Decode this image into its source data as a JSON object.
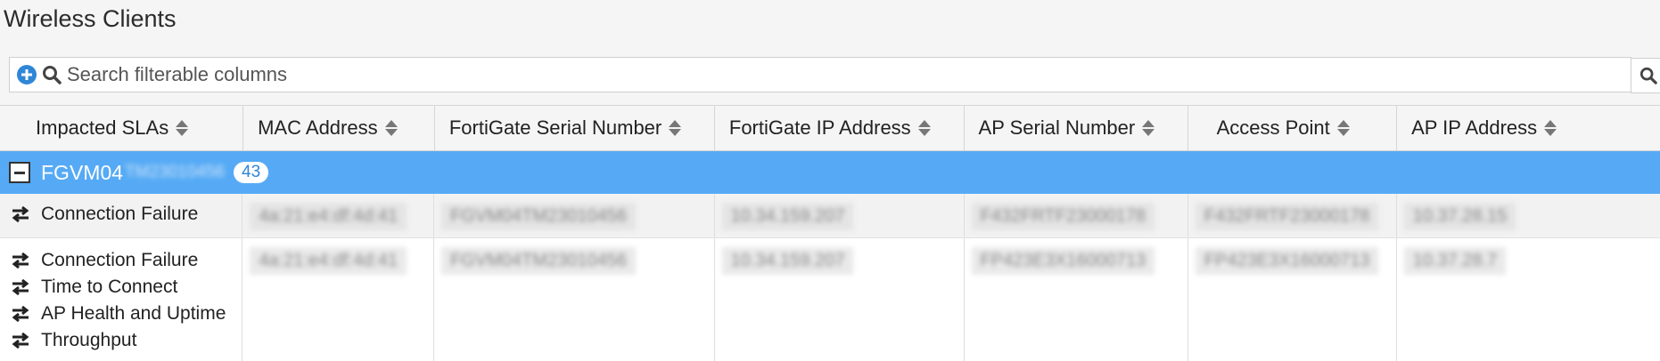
{
  "page": {
    "title": "Wireless Clients"
  },
  "search": {
    "placeholder": "Search filterable columns"
  },
  "columns": [
    {
      "label": "Impacted SLAs"
    },
    {
      "label": "MAC Address"
    },
    {
      "label": "FortiGate Serial Number"
    },
    {
      "label": "FortiGate IP Address"
    },
    {
      "label": "AP Serial Number"
    },
    {
      "label": "Access Point"
    },
    {
      "label": "AP IP Address"
    }
  ],
  "group": {
    "name": "FGVM04",
    "name_rest": "TM23010456",
    "count": "43"
  },
  "rows": [
    {
      "slas": [
        "Connection Failure"
      ],
      "mac": "4a:21:e4:df:4d:41",
      "fgt_serial": "FGVM04TM23010456",
      "fgt_ip": "10.34.159.207",
      "ap_serial": "F432FRTF23000178",
      "access_point": "F432FRTF23000178",
      "ap_ip": "10.37.28.15"
    },
    {
      "slas": [
        "Connection Failure",
        "Time to Connect",
        "AP Health and Uptime",
        "Throughput"
      ],
      "mac": "4a:21:e4:df:4d:41",
      "fgt_serial": "FGVM04TM23010456",
      "fgt_ip": "10.34.159.207",
      "ap_serial": "FP423E3X16000713",
      "access_point": "FP423E3X16000713",
      "ap_ip": "10.37.28.7"
    }
  ],
  "icons": {
    "add": "plus-circle-icon",
    "search": "search-icon",
    "collapse": "minus-square-icon",
    "sla": "swap-arrows-icon",
    "sort": "sort-icon"
  },
  "colors": {
    "group_row": "#56aaf5",
    "accent": "#2f86d6"
  }
}
